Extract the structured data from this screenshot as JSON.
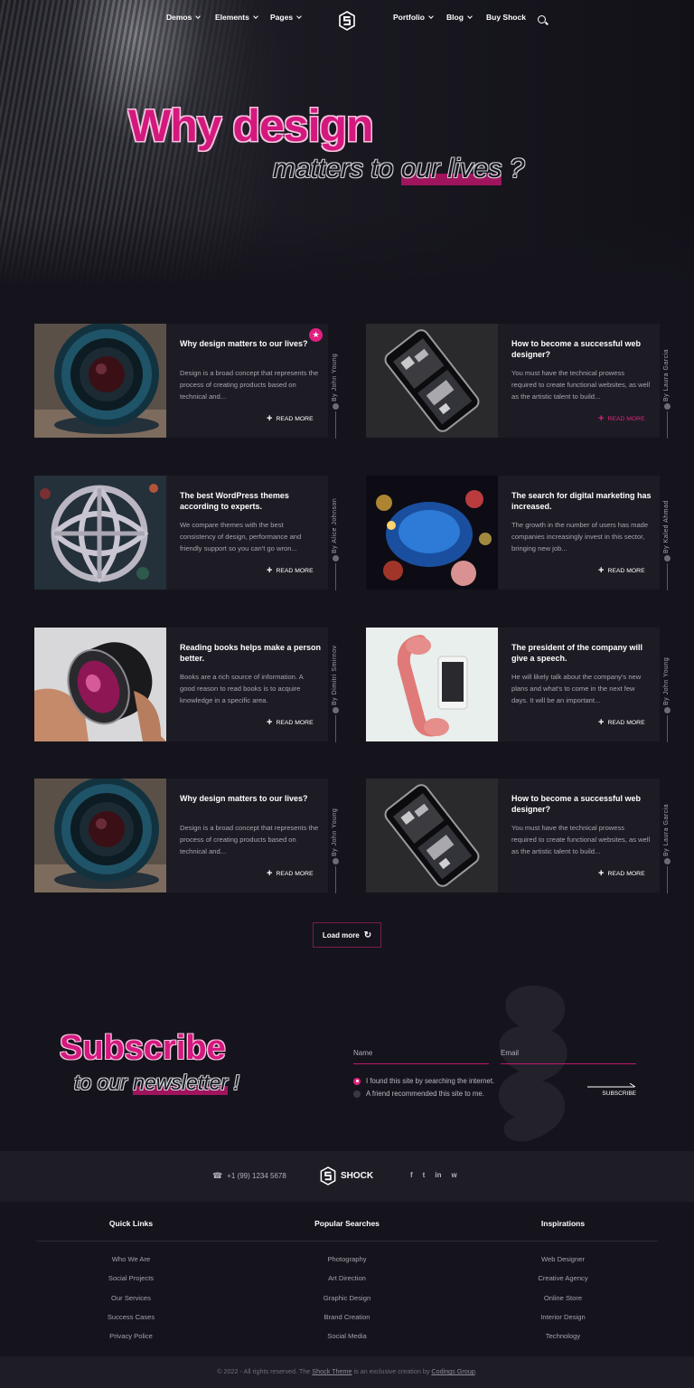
{
  "nav": {
    "left": [
      "Demos",
      "Elements",
      "Pages"
    ],
    "right": [
      "Portfolio",
      "Blog"
    ],
    "buy": "Buy Shock"
  },
  "hero": {
    "title": "Why design",
    "sub_pre": "matters to ",
    "sub_highlight": "our lives",
    "sub_post": " ?"
  },
  "posts": [
    {
      "title": "Why design matters to our lives?",
      "text": "Design is a broad concept that represents the process of creating products based on technical and...",
      "author": "By John Young",
      "read_more": "READ MORE",
      "image": "camera-lens-image"
    },
    {
      "title": "How to become a successful web designer?",
      "text": "You must have the technical prowess required to create functional websites, as well as the artistic talent to build...",
      "author": "By Laura Garcia",
      "read_more": "READ MORE",
      "image": "phone-circuit-image"
    },
    {
      "title": "The best WordPress themes according to experts.",
      "text": "We compare themes with the best consistency of design, performance and friendly support so you can't go wron...",
      "author": "By Alice Johnson",
      "read_more": "READ MORE",
      "image": "lattice-ornament-image"
    },
    {
      "title": "The search for digital marketing has increased.",
      "text": "The growth in the number of users has made companies increasingly invest in this sector, bringing new job...",
      "author": "By Kaled Ahmad",
      "read_more": "READ MORE",
      "image": "bokeh-lights-image"
    },
    {
      "title": "Reading books helps make a person better.",
      "text": "Books are a rich source of information. A good reason to read books is to acquire knowledge in a specific area.",
      "author": "By Dimitri Smirnov",
      "read_more": "READ MORE",
      "image": "hand-lens-image"
    },
    {
      "title": "The president of the company will give a speech.",
      "text": "He will likely talk about the company's new plans and what's to come in the next few days. It will be an important...",
      "author": "By John Young",
      "read_more": "READ MORE",
      "image": "phone-handset-image"
    },
    {
      "title": "Why design matters to our lives?",
      "text": "Design is a broad concept that represents the process of creating products based on technical and...",
      "author": "By John Young",
      "read_more": "READ MORE",
      "image": "camera-lens-image"
    },
    {
      "title": "How to become a successful web designer?",
      "text": "You must have the technical prowess required to create functional websites, as well as the artistic talent to build...",
      "author": "By Laura Garcia",
      "read_more": "READ MORE",
      "image": "phone-circuit-image"
    }
  ],
  "load_more": "Load more",
  "subscribe": {
    "title": "Subscribe",
    "sub_pre": "to our ",
    "sub_highlight": "newsletter",
    "sub_post": " !",
    "name_placeholder": "Name",
    "email_placeholder": "Email",
    "options": [
      "I found this site by searching the internet.",
      "A friend recommended this site to me."
    ],
    "button": "SUBSCRIBE"
  },
  "footer": {
    "phone": "+1 (99) 1234 5678",
    "brand": "SHOCK",
    "socials": [
      "f",
      "t",
      "in",
      "w"
    ],
    "columns": [
      {
        "title": "Quick Links",
        "links": [
          "Who We Are",
          "Social Projects",
          "Our Services",
          "Success Cases",
          "Privacy Police"
        ]
      },
      {
        "title": "Popular Searches",
        "links": [
          "Photography",
          "Art Direction",
          "Graphic Design",
          "Brand Creation",
          "Social Media"
        ]
      },
      {
        "title": "Inspirations",
        "links": [
          "Web Designer",
          "Creative Agency",
          "Online Store",
          "Interior Design",
          "Technology"
        ]
      }
    ],
    "copyright_pre": "© 2022 - All rights reserved. The ",
    "copyright_theme": "Shock Theme",
    "copyright_mid": " is an exclusive creation by ",
    "copyright_group": "Codings Group",
    "copyright_post": "."
  },
  "colors": {
    "accent": "#e0207f",
    "background": "#15141c",
    "card": "#1d1c24"
  }
}
